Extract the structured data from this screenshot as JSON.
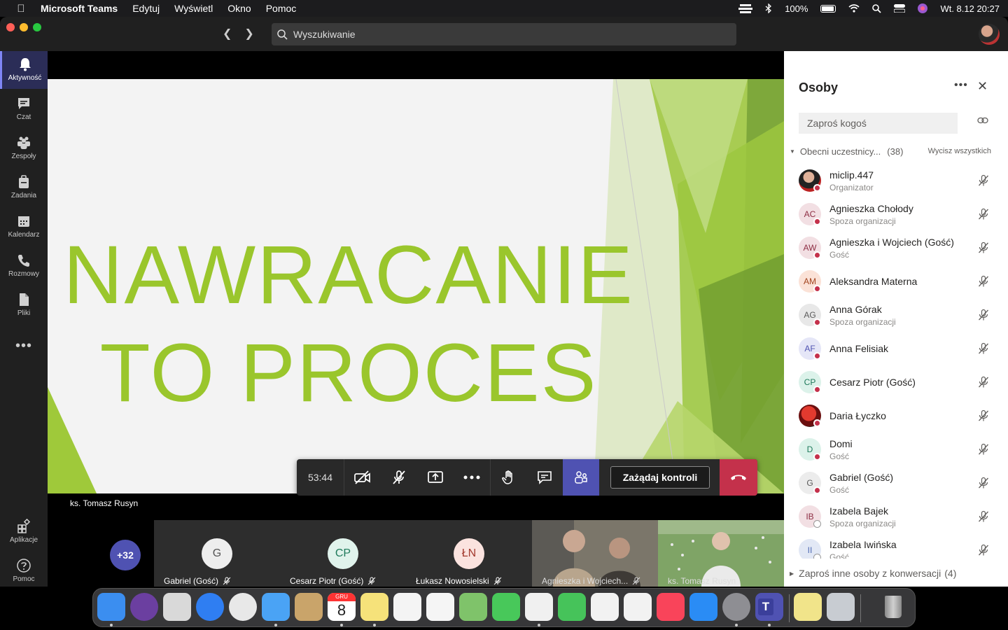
{
  "menubar": {
    "app_name": "Microsoft Teams",
    "items": [
      "Edytuj",
      "Wyświetl",
      "Okno",
      "Pomoc"
    ],
    "battery": "100%",
    "datetime": "Wt. 8.12  20:27"
  },
  "search": {
    "placeholder": "Wyszukiwanie"
  },
  "rail": {
    "items": [
      {
        "label": "Aktywność",
        "icon": "bell-icon"
      },
      {
        "label": "Czat",
        "icon": "chat-icon"
      },
      {
        "label": "Zespoły",
        "icon": "teams-icon"
      },
      {
        "label": "Zadania",
        "icon": "briefcase-icon"
      },
      {
        "label": "Kalendarz",
        "icon": "calendar-icon"
      },
      {
        "label": "Rozmowy",
        "icon": "phone-icon"
      },
      {
        "label": "Pliki",
        "icon": "file-icon"
      }
    ],
    "more": "•••",
    "apps_label": "Aplikacje",
    "help_label": "Pomoc"
  },
  "slide": {
    "line1": "NAWRACANIE",
    "line2": "TO PROCES"
  },
  "presenter": "ks. Tomasz Rusyn",
  "controls": {
    "timer": "53:44",
    "request_control": "Zażądaj kontroli"
  },
  "gallery": {
    "overflow": "+32",
    "tiles": [
      {
        "initials": "G",
        "name": "Gabriel (Gość)"
      },
      {
        "initials": "CP",
        "name": "Cesarz Piotr (Gość)"
      },
      {
        "initials": "ŁN",
        "name": "Łukasz Nowosielski"
      },
      {
        "initials": "",
        "name": "Agnieszka i Wojciech..."
      },
      {
        "initials": "",
        "name": "ks. Tomasz Rusyn"
      }
    ]
  },
  "panel": {
    "title": "Osoby",
    "invite_placeholder": "Zaproś kogoś",
    "section_label": "Obecni uczestnicy...",
    "section_count": "(38)",
    "mute_all": "Wycisz wszystkich",
    "people": [
      {
        "initials": "",
        "name": "miclip.447",
        "role": "Organizator",
        "color": "#2a2a2a",
        "bg": "#d9a58e",
        "photo": true
      },
      {
        "initials": "AC",
        "name": "Agnieszka Chołody",
        "role": "Spoza organizacji",
        "color": "#8e2e44",
        "bg": "#f2dfe3"
      },
      {
        "initials": "AW",
        "name": "Agnieszka i Wojciech (Gość)",
        "role": "Gość",
        "color": "#8e2e44",
        "bg": "#f2dfe3"
      },
      {
        "initials": "AM",
        "name": "Aleksandra Materna",
        "role": "",
        "color": "#a2431d",
        "bg": "#fbe2d7"
      },
      {
        "initials": "AG",
        "name": "Anna Górak",
        "role": "Spoza organizacji",
        "color": "#5a5a5a",
        "bg": "#e8e8e8"
      },
      {
        "initials": "AF",
        "name": "Anna Felisiak",
        "role": "",
        "color": "#4f52b2",
        "bg": "#e5e6f7"
      },
      {
        "initials": "CP",
        "name": "Cesarz Piotr (Gość)",
        "role": "",
        "color": "#1f7a5b",
        "bg": "#dcf2ea"
      },
      {
        "initials": "",
        "name": "Daria Łyczko",
        "role": "",
        "color": "#fff",
        "bg": "#b32020",
        "photo": true
      },
      {
        "initials": "D",
        "name": "Domi",
        "role": "Gość",
        "color": "#1f7a5b",
        "bg": "#dcf2ea"
      },
      {
        "initials": "G",
        "name": "Gabriel (Gość)",
        "role": "Gość",
        "color": "#5a5a5a",
        "bg": "#ececec"
      },
      {
        "initials": "IB",
        "name": "Izabela Bajek",
        "role": "Spoza organizacji",
        "color": "#8e2e44",
        "bg": "#f2dfe3"
      },
      {
        "initials": "II",
        "name": "Izabela Iwińska",
        "role": "Gość",
        "color": "#4f6bb2",
        "bg": "#e2e8f5"
      }
    ],
    "invite_more": "Zaproś inne osoby z konwersacji",
    "invite_more_count": "(4)"
  },
  "dock": {
    "apps": [
      {
        "icon": "finder-icon",
        "color": "#3b8ef0"
      },
      {
        "icon": "siri-icon",
        "color": "#6b3fa0"
      },
      {
        "icon": "launchpad-icon",
        "color": "#d9d9d9"
      },
      {
        "icon": "safari-icon",
        "color": "#2f7ef2"
      },
      {
        "icon": "chrome-icon",
        "color": "#e8e8e8"
      },
      {
        "icon": "mail-icon",
        "color": "#4aa3f5"
      },
      {
        "icon": "contacts-icon",
        "color": "#c9a46a"
      },
      {
        "icon": "calendar-icon",
        "color": "#ffffff"
      },
      {
        "icon": "notes-icon",
        "color": "#f6e27a"
      },
      {
        "icon": "reminders-icon",
        "color": "#f4f4f4"
      },
      {
        "icon": "photos-icon",
        "color": "#f5f5f5"
      },
      {
        "icon": "maps-icon",
        "color": "#7fc36a"
      },
      {
        "icon": "messages-icon",
        "color": "#48c85a"
      },
      {
        "icon": "pages-icon",
        "color": "#f0f0f0"
      },
      {
        "icon": "facetime-icon",
        "color": "#46c35a"
      },
      {
        "icon": "numbers-icon",
        "color": "#f2f2f2"
      },
      {
        "icon": "keynote-icon",
        "color": "#f2f2f2"
      },
      {
        "icon": "music-icon",
        "color": "#f9445a"
      },
      {
        "icon": "appstore-icon",
        "color": "#2a8cf5"
      },
      {
        "icon": "settings-icon",
        "color": "#8e8e93"
      },
      {
        "icon": "teams-app-icon",
        "color": "#4f52b2"
      },
      {
        "icon": "stickies-icon",
        "color": "#f1e48a"
      },
      {
        "icon": "scanner-icon",
        "color": "#c8ccd2"
      },
      {
        "icon": "trash-icon",
        "color": "#9a9a9a"
      }
    ],
    "calendar_month": "GRU",
    "calendar_day": "8"
  }
}
